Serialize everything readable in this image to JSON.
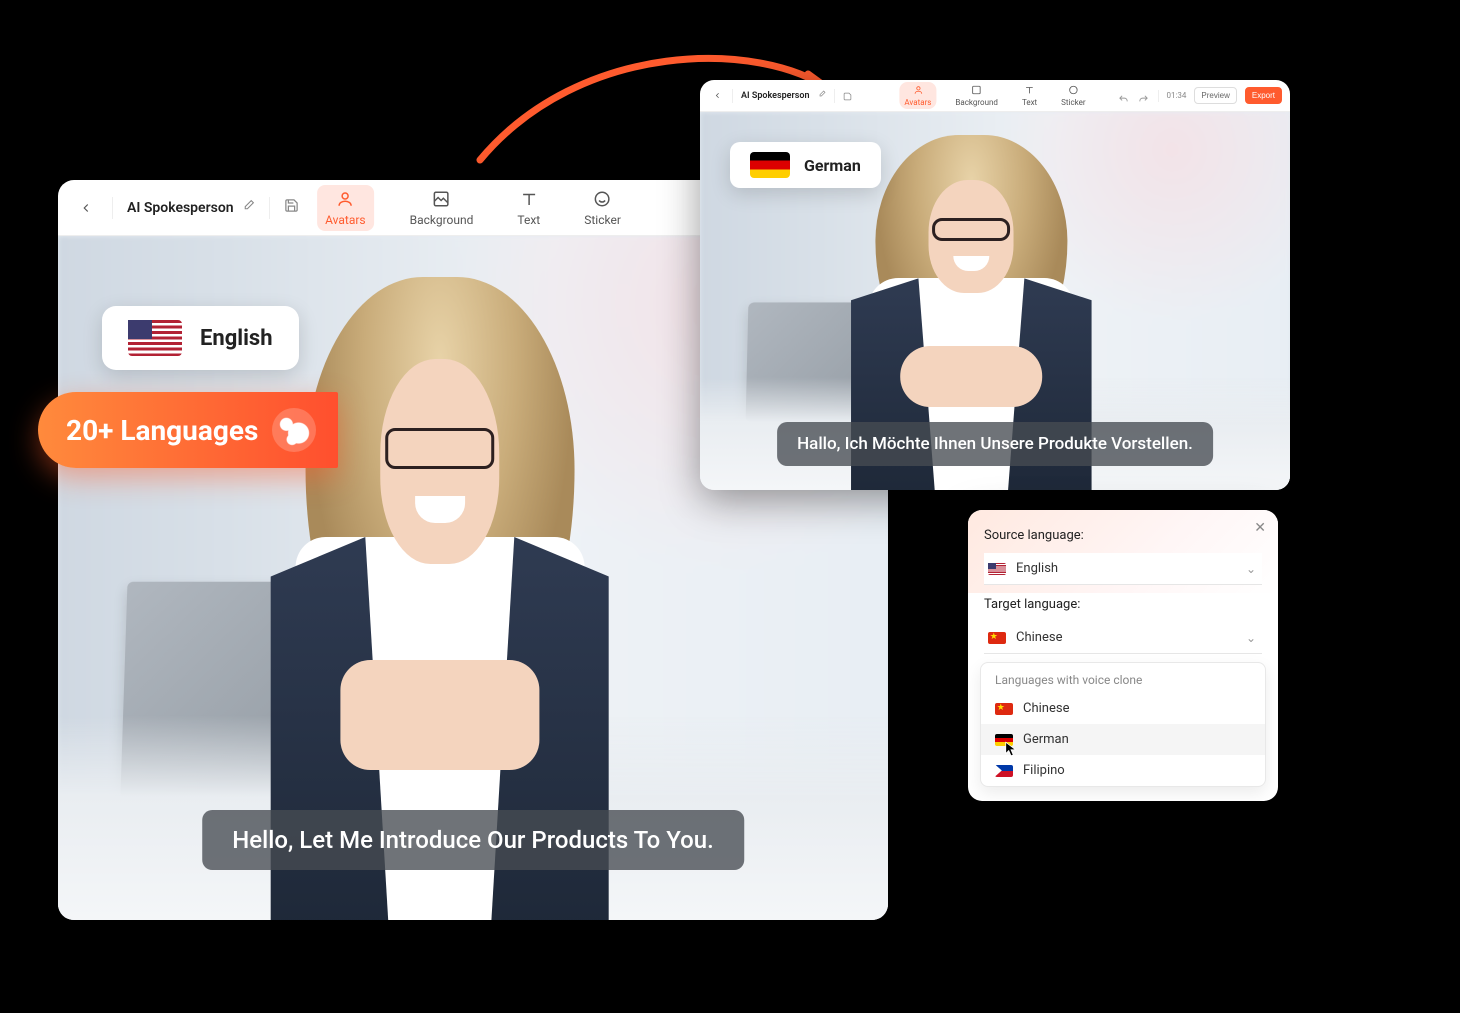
{
  "editor": {
    "title": "AI Spokesperson",
    "tabs": {
      "avatars": "Avatars",
      "background": "Background",
      "text": "Text",
      "sticker": "Sticker"
    }
  },
  "left": {
    "lang_label": "English",
    "caption": "Hello,  Let Me Introduce Our Products To You."
  },
  "right": {
    "lang_label": "German",
    "caption": "Hallo, Ich Möchte Ihnen Unsere Produkte Vorstellen.",
    "time": "01:34",
    "preview": "Preview",
    "export": "Export"
  },
  "pill": {
    "text": "20+ Languages"
  },
  "panel": {
    "source_label": "Source language:",
    "source_value": "English",
    "target_label": "Target language:",
    "target_value": "Chinese",
    "dd_header": "Languages with voice clone",
    "opts": {
      "chinese": "Chinese",
      "german": "German",
      "filipino": "Filipino"
    }
  }
}
